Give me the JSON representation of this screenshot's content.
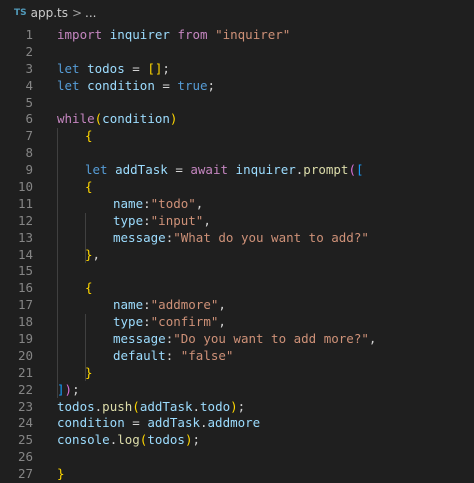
{
  "breadcrumb": {
    "language_badge": "TS",
    "file": "app.ts",
    "separator": ">",
    "rest": "..."
  },
  "editor": {
    "lines": [
      {
        "n": "1",
        "indent": 0,
        "tokens": [
          {
            "t": "import",
            "c": "ctrl"
          },
          {
            "t": " "
          },
          {
            "t": "inquirer",
            "c": "var"
          },
          {
            "t": " "
          },
          {
            "t": "from",
            "c": "ctrl"
          },
          {
            "t": " "
          },
          {
            "t": "\"inquirer\"",
            "c": "str"
          }
        ]
      },
      {
        "n": "2",
        "indent": 0,
        "tokens": []
      },
      {
        "n": "3",
        "indent": 0,
        "tokens": [
          {
            "t": "let",
            "c": "kw"
          },
          {
            "t": " "
          },
          {
            "t": "todos",
            "c": "var"
          },
          {
            "t": " = "
          },
          {
            "t": "[]",
            "c": "b1"
          },
          {
            "t": ";"
          }
        ]
      },
      {
        "n": "4",
        "indent": 0,
        "tokens": [
          {
            "t": "let",
            "c": "kw"
          },
          {
            "t": " "
          },
          {
            "t": "condition",
            "c": "var"
          },
          {
            "t": " = "
          },
          {
            "t": "true",
            "c": "kw"
          },
          {
            "t": ";"
          }
        ]
      },
      {
        "n": "5",
        "indent": 0,
        "tokens": []
      },
      {
        "n": "6",
        "indent": 0,
        "tokens": [
          {
            "t": "while",
            "c": "ctrl"
          },
          {
            "t": "(",
            "c": "b1"
          },
          {
            "t": "condition",
            "c": "var"
          },
          {
            "t": ")",
            "c": "b1"
          }
        ]
      },
      {
        "n": "7",
        "indent": 1,
        "tokens": [
          {
            "t": "{",
            "c": "b1"
          }
        ]
      },
      {
        "n": "8",
        "indent": 0,
        "tokens": []
      },
      {
        "n": "9",
        "indent": 1,
        "tokens": [
          {
            "t": "let",
            "c": "kw"
          },
          {
            "t": " "
          },
          {
            "t": "addTask",
            "c": "var"
          },
          {
            "t": " = "
          },
          {
            "t": "await",
            "c": "ctrl"
          },
          {
            "t": " "
          },
          {
            "t": "inquirer",
            "c": "var"
          },
          {
            "t": "."
          },
          {
            "t": "prompt",
            "c": "fn"
          },
          {
            "t": "(",
            "c": "b2"
          },
          {
            "t": "[",
            "c": "b3"
          }
        ]
      },
      {
        "n": "10",
        "indent": 1,
        "tokens": [
          {
            "t": "{",
            "c": "b1"
          }
        ]
      },
      {
        "n": "11",
        "indent": 2,
        "tokens": [
          {
            "t": "name",
            "c": "var"
          },
          {
            "t": ":"
          },
          {
            "t": "\"todo\"",
            "c": "str"
          },
          {
            "t": ","
          }
        ]
      },
      {
        "n": "12",
        "indent": 2,
        "tokens": [
          {
            "t": "type",
            "c": "var"
          },
          {
            "t": ":"
          },
          {
            "t": "\"input\"",
            "c": "str"
          },
          {
            "t": ","
          }
        ]
      },
      {
        "n": "13",
        "indent": 2,
        "tokens": [
          {
            "t": "message",
            "c": "var"
          },
          {
            "t": ":"
          },
          {
            "t": "\"What do you want to add?\"",
            "c": "str"
          }
        ]
      },
      {
        "n": "14",
        "indent": 1,
        "tokens": [
          {
            "t": "}",
            "c": "b1"
          },
          {
            "t": ","
          }
        ]
      },
      {
        "n": "15",
        "indent": 0,
        "tokens": []
      },
      {
        "n": "16",
        "indent": 1,
        "tokens": [
          {
            "t": "{",
            "c": "b1"
          }
        ]
      },
      {
        "n": "17",
        "indent": 2,
        "tokens": [
          {
            "t": "name",
            "c": "var"
          },
          {
            "t": ":"
          },
          {
            "t": "\"addmore\"",
            "c": "str"
          },
          {
            "t": ","
          }
        ]
      },
      {
        "n": "18",
        "indent": 2,
        "tokens": [
          {
            "t": "type",
            "c": "var"
          },
          {
            "t": ":"
          },
          {
            "t": "\"confirm\"",
            "c": "str"
          },
          {
            "t": ","
          }
        ]
      },
      {
        "n": "19",
        "indent": 2,
        "tokens": [
          {
            "t": "message",
            "c": "var"
          },
          {
            "t": ":"
          },
          {
            "t": "\"Do you want to add more?\"",
            "c": "str"
          },
          {
            "t": ","
          }
        ]
      },
      {
        "n": "20",
        "indent": 2,
        "tokens": [
          {
            "t": "default",
            "c": "var"
          },
          {
            "t": ": "
          },
          {
            "t": "\"false\"",
            "c": "str"
          }
        ]
      },
      {
        "n": "21",
        "indent": 1,
        "tokens": [
          {
            "t": "}",
            "c": "b1"
          }
        ]
      },
      {
        "n": "22",
        "indent": 0,
        "tokens": [
          {
            "t": "]",
            "c": "b3"
          },
          {
            "t": ")",
            "c": "b2"
          },
          {
            "t": ";"
          }
        ]
      },
      {
        "n": "23",
        "indent": 0,
        "tokens": [
          {
            "t": "todos",
            "c": "var"
          },
          {
            "t": "."
          },
          {
            "t": "push",
            "c": "fn"
          },
          {
            "t": "(",
            "c": "b1"
          },
          {
            "t": "addTask",
            "c": "var"
          },
          {
            "t": "."
          },
          {
            "t": "todo",
            "c": "var"
          },
          {
            "t": ")",
            "c": "b1"
          },
          {
            "t": ";"
          }
        ]
      },
      {
        "n": "24",
        "indent": 0,
        "tokens": [
          {
            "t": "condition",
            "c": "var"
          },
          {
            "t": " = "
          },
          {
            "t": "addTask",
            "c": "var"
          },
          {
            "t": "."
          },
          {
            "t": "addmore",
            "c": "var"
          }
        ]
      },
      {
        "n": "25",
        "indent": 0,
        "tokens": [
          {
            "t": "console",
            "c": "var"
          },
          {
            "t": "."
          },
          {
            "t": "log",
            "c": "fn"
          },
          {
            "t": "(",
            "c": "b1"
          },
          {
            "t": "todos",
            "c": "var"
          },
          {
            "t": ")",
            "c": "b1"
          },
          {
            "t": ";"
          }
        ]
      },
      {
        "n": "26",
        "indent": 0,
        "tokens": []
      },
      {
        "n": "27",
        "indent": 0,
        "tokens": [
          {
            "t": "}",
            "c": "b1"
          }
        ]
      }
    ]
  },
  "colors": {
    "background": "#1f1f1f",
    "keyword": "#569cd6",
    "control": "#c586c0",
    "variable": "#9cdcfe",
    "function": "#dcdcaa",
    "string": "#ce9178",
    "bracket_level1": "#ffd700",
    "bracket_level2": "#da70d6",
    "bracket_level3": "#179fff"
  }
}
